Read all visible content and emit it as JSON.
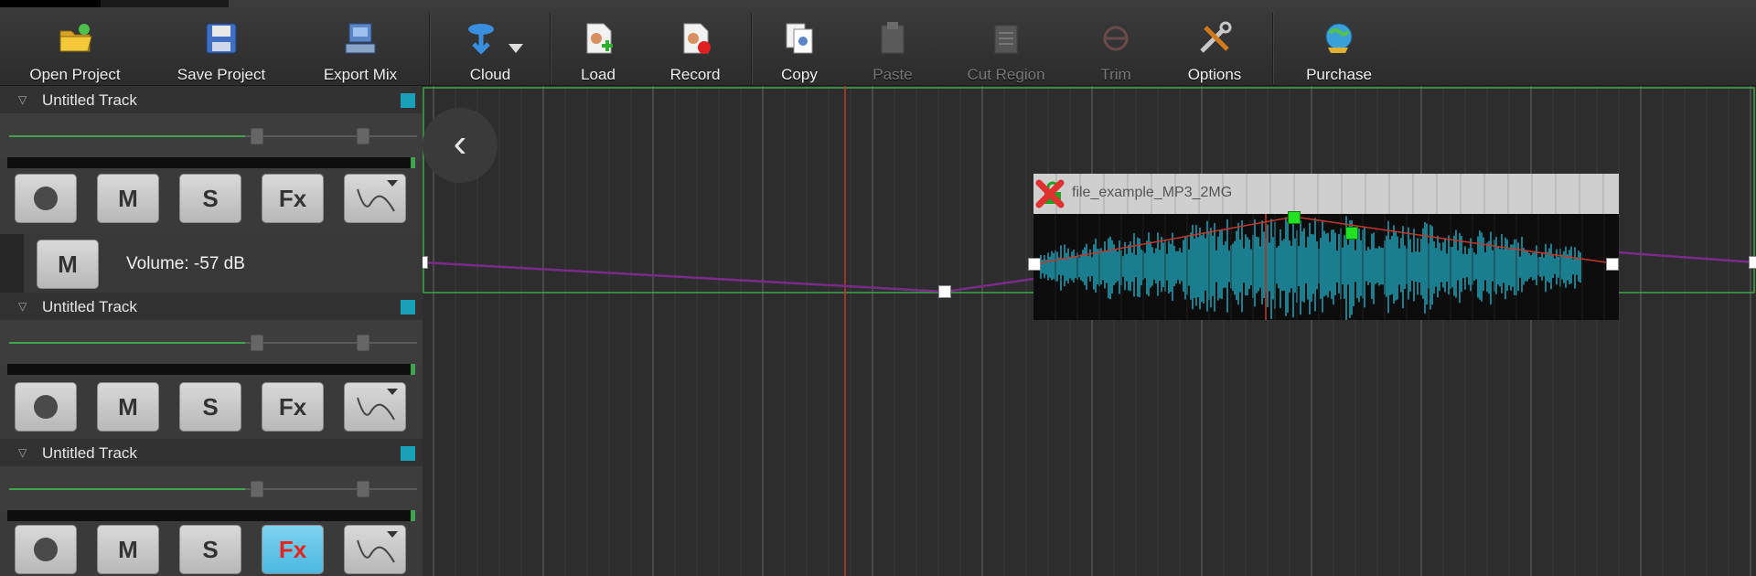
{
  "toolbar": {
    "buttons": [
      {
        "label": "Open Project",
        "icon": "folder-open-icon"
      },
      {
        "label": "Save Project",
        "icon": "floppy-disk-icon"
      },
      {
        "label": "Export Mix",
        "icon": "export-mix-icon"
      },
      {
        "label": "Cloud",
        "icon": "cloud-icon"
      },
      {
        "label": "Load",
        "icon": "load-file-icon"
      },
      {
        "label": "Record",
        "icon": "record-file-icon"
      },
      {
        "label": "Copy",
        "icon": "copy-icon"
      },
      {
        "label": "Paste",
        "icon": "paste-icon",
        "disabled": true
      },
      {
        "label": "Cut Region",
        "icon": "cut-region-icon",
        "disabled": true
      },
      {
        "label": "Trim",
        "icon": "trim-icon",
        "disabled": true
      },
      {
        "label": "Options",
        "icon": "tools-icon"
      },
      {
        "label": "Purchase",
        "icon": "globe-cart-icon"
      }
    ]
  },
  "tracks": [
    {
      "name": "Untitled Track",
      "color": "#1aa0b8",
      "fx_active": false
    },
    {
      "name": "Untitled Track",
      "color": "#1aa0b8",
      "fx_active": false
    },
    {
      "name": "Untitled Track",
      "color": "#1aa0b8",
      "fx_active": true
    }
  ],
  "track_buttons": {
    "mute": "M",
    "solo": "S",
    "fx": "Fx"
  },
  "automation": {
    "mute_label": "M",
    "volume_text": "Volume: -57 dB",
    "line_color": "#7a2a88"
  },
  "clip": {
    "name": "file_example_MP3_2MG",
    "waveform_color": "#1e9bb0",
    "envelope_color": "#c0392b"
  },
  "colors": {
    "accent_green": "#3fa34d",
    "playhead": "#c0392b",
    "grid": "#3c3c3c"
  }
}
